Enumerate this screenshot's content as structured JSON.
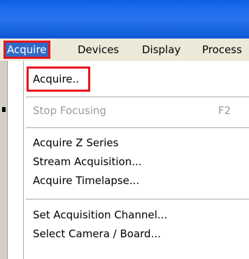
{
  "menubar": {
    "items": [
      {
        "label": "Acquire"
      },
      {
        "label": "Devices"
      },
      {
        "label": "Display"
      },
      {
        "label": "Process"
      }
    ]
  },
  "dropdown": {
    "items": [
      {
        "label": "Acquire.",
        "suffix": "."
      },
      {
        "label": "Stop Focusing",
        "shortcut": "F2",
        "disabled": true
      },
      {
        "label": "Acquire Z Series"
      },
      {
        "label": "Stream Acquisition..."
      },
      {
        "label": "Acquire Timelapse..."
      },
      {
        "label": "Set Acquisition Channel..."
      },
      {
        "label": "Select Camera / Board..."
      }
    ]
  },
  "colors": {
    "titlebar": "#1f6fee",
    "menu_active": "#316ac5",
    "annotation": "#e8141c",
    "disabled_text": "#9b9b9b"
  }
}
